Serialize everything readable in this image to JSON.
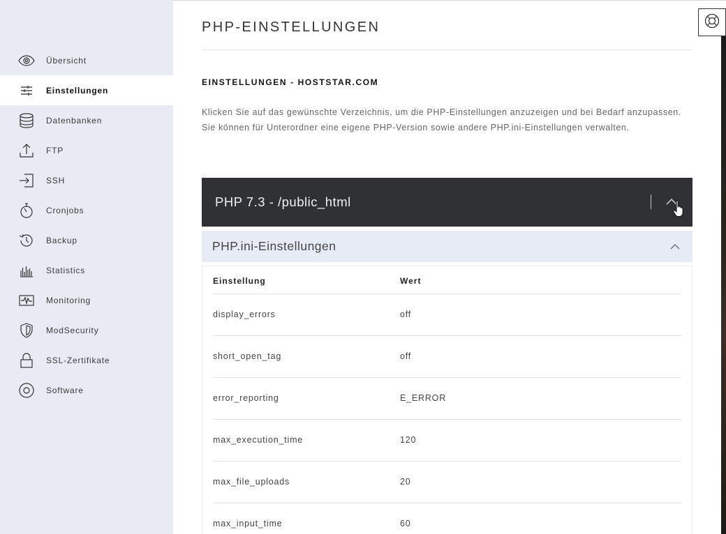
{
  "sidebar": {
    "items": [
      {
        "label": "Übersicht",
        "icon": "eye-icon",
        "active": false
      },
      {
        "label": "Einstellungen",
        "icon": "sliders-icon",
        "active": true
      },
      {
        "label": "Datenbanken",
        "icon": "database-icon",
        "active": false
      },
      {
        "label": "FTP",
        "icon": "upload-icon",
        "active": false
      },
      {
        "label": "SSH",
        "icon": "login-icon",
        "active": false
      },
      {
        "label": "Cronjobs",
        "icon": "stopwatch-icon",
        "active": false
      },
      {
        "label": "Backup",
        "icon": "history-icon",
        "active": false
      },
      {
        "label": "Statistics",
        "icon": "bar-chart-icon",
        "active": false
      },
      {
        "label": "Monitoring",
        "icon": "pulse-icon",
        "active": false
      },
      {
        "label": "ModSecurity",
        "icon": "shield-icon",
        "active": false
      },
      {
        "label": "SSL-Zertifikate",
        "icon": "lock-icon",
        "active": false
      },
      {
        "label": "Software",
        "icon": "disc-icon",
        "active": false
      }
    ]
  },
  "main": {
    "page_title": "PHP-EINSTELLUNGEN",
    "section_title": "EINSTELLUNGEN - HOSTSTAR.COM",
    "description": "Klicken Sie auf das gewünschte Verzeichnis, um die PHP-Einstellungen anzuzeigen und bei Bedarf anzupassen. Sie können für Unterordner eine eigene PHP-Version sowie andere PHP.ini-Einstellungen verwalten.",
    "php_panel": {
      "title": "PHP 7.3 - /public_html"
    },
    "ini_panel": {
      "title": "PHP.ini-Einstellungen"
    },
    "table": {
      "headers": [
        "Einstellung",
        "Wert"
      ],
      "rows": [
        [
          "display_errors",
          "off"
        ],
        [
          "short_open_tag",
          "off"
        ],
        [
          "error_reporting",
          "E_ERROR"
        ],
        [
          "max_execution_time",
          "120"
        ],
        [
          "max_file_uploads",
          "20"
        ],
        [
          "max_input_time",
          "60"
        ]
      ]
    }
  },
  "help_button": {
    "icon": "lifebuoy-icon"
  },
  "colors": {
    "sidebar_bg": "#e8ebf4",
    "php_bar_bg": "#303134",
    "ini_bar_bg": "#e7ebf5"
  }
}
